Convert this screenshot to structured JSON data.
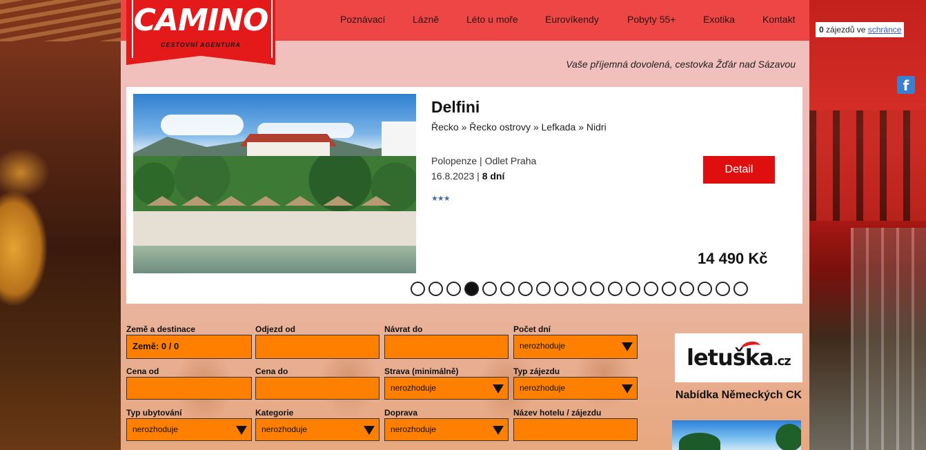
{
  "brand": {
    "name": "CAMINO",
    "subtitle": "CESTOVNÍ AGENTURA"
  },
  "nav": [
    {
      "label": "Poznávací"
    },
    {
      "label": "Lázně"
    },
    {
      "label": "Léto u moře"
    },
    {
      "label": "Eurovíkendy"
    },
    {
      "label": "Pobyty 55+"
    },
    {
      "label": "Exotika"
    },
    {
      "label": "Kontakt"
    }
  ],
  "tagline": "Vaše příjemná dovolená, cestovka Žďár nad Sázavou",
  "cart": {
    "count": "0",
    "text": " zájezdů ve ",
    "link": "schránce"
  },
  "facebook_icon": "f",
  "featured": {
    "title": "Delfini",
    "breadcrumb": "Řecko » Řecko ostrovy » Lefkada » Nidri",
    "meal_departure": "Polopenze | Odlet Praha",
    "date": "16.8.2023 | ",
    "duration": "8 dní",
    "stars": "★★★",
    "detail_label": "Detail",
    "price": "14 490 Kč",
    "slides_total": 19,
    "active_slide": 4
  },
  "search": {
    "fields": [
      {
        "label": "Země a destinace",
        "value": "Země: 0 / 0",
        "type": "text-bold"
      },
      {
        "label": "Odjezd od",
        "value": "",
        "type": "text"
      },
      {
        "label": "Návrat do",
        "value": "",
        "type": "text"
      },
      {
        "label": "Počet dní",
        "value": "nerozhoduje",
        "type": "select"
      },
      {
        "label": "Cena od",
        "value": "",
        "type": "text"
      },
      {
        "label": "Cena do",
        "value": "",
        "type": "text"
      },
      {
        "label": "Strava (minimálně)",
        "value": "nerozhoduje",
        "type": "select"
      },
      {
        "label": "Typ zájezdu",
        "value": "nerozhoduje",
        "type": "select"
      },
      {
        "label": "Typ ubytování",
        "value": "nerozhoduje",
        "type": "select"
      },
      {
        "label": "Kategorie",
        "value": "nerozhoduje",
        "type": "select"
      },
      {
        "label": "Doprava",
        "value": "nerozhoduje",
        "type": "select"
      },
      {
        "label": "Název hotelu / zájezdu",
        "value": "",
        "type": "text"
      }
    ]
  },
  "sidebar": {
    "partner_logo": "letuška",
    "partner_logo_suffix": ".cz",
    "heading": "Nabídka Německých CK"
  }
}
